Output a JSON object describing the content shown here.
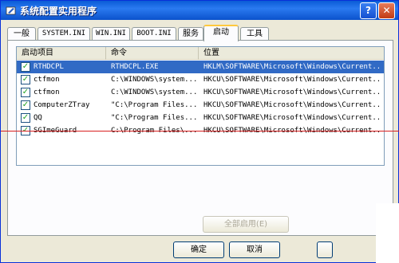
{
  "window": {
    "title": "系统配置实用程序",
    "help_btn": "?",
    "close_btn": "✕"
  },
  "tabs": [
    "一般",
    "SYSTEM.INI",
    "WIN.INI",
    "BOOT.INI",
    "服务",
    "启动",
    "工具"
  ],
  "list": {
    "columns": [
      "启动项目",
      "命令",
      "位置"
    ],
    "rows": [
      {
        "checked": true,
        "item": "RTHDCPL",
        "command": "RTHDCPL.EXE",
        "location": "HKLM\\SOFTWARE\\Microsoft\\Windows\\Current..."
      },
      {
        "checked": true,
        "item": "ctfmon",
        "command": "C:\\WINDOWS\\system...",
        "location": "HKCU\\SOFTWARE\\Microsoft\\Windows\\Current..."
      },
      {
        "checked": true,
        "item": "ctfmon",
        "command": "C:\\WINDOWS\\system...",
        "location": "HKCU\\SOFTWARE\\Microsoft\\Windows\\Current..."
      },
      {
        "checked": true,
        "item": "ComputerZTray",
        "command": "\"C:\\Program Files...",
        "location": "HKCU\\SOFTWARE\\Microsoft\\Windows\\Current..."
      },
      {
        "checked": true,
        "item": "QQ",
        "command": "\"C:\\Program Files...",
        "location": "HKCU\\SOFTWARE\\Microsoft\\Windows\\Current..."
      },
      {
        "checked": true,
        "item": "SGImeGuard",
        "command": "C:\\Program Files\\...",
        "location": "HKCU\\SOFTWARE\\Microsoft\\Windows\\Current..."
      }
    ]
  },
  "buttons": {
    "enable_all": "全部启用(E)",
    "ok": "确定",
    "cancel": "取消"
  },
  "colors": {
    "selection": "#316ac5",
    "titlebar": "#0a5bd6",
    "annotation_line": "#d82020"
  }
}
